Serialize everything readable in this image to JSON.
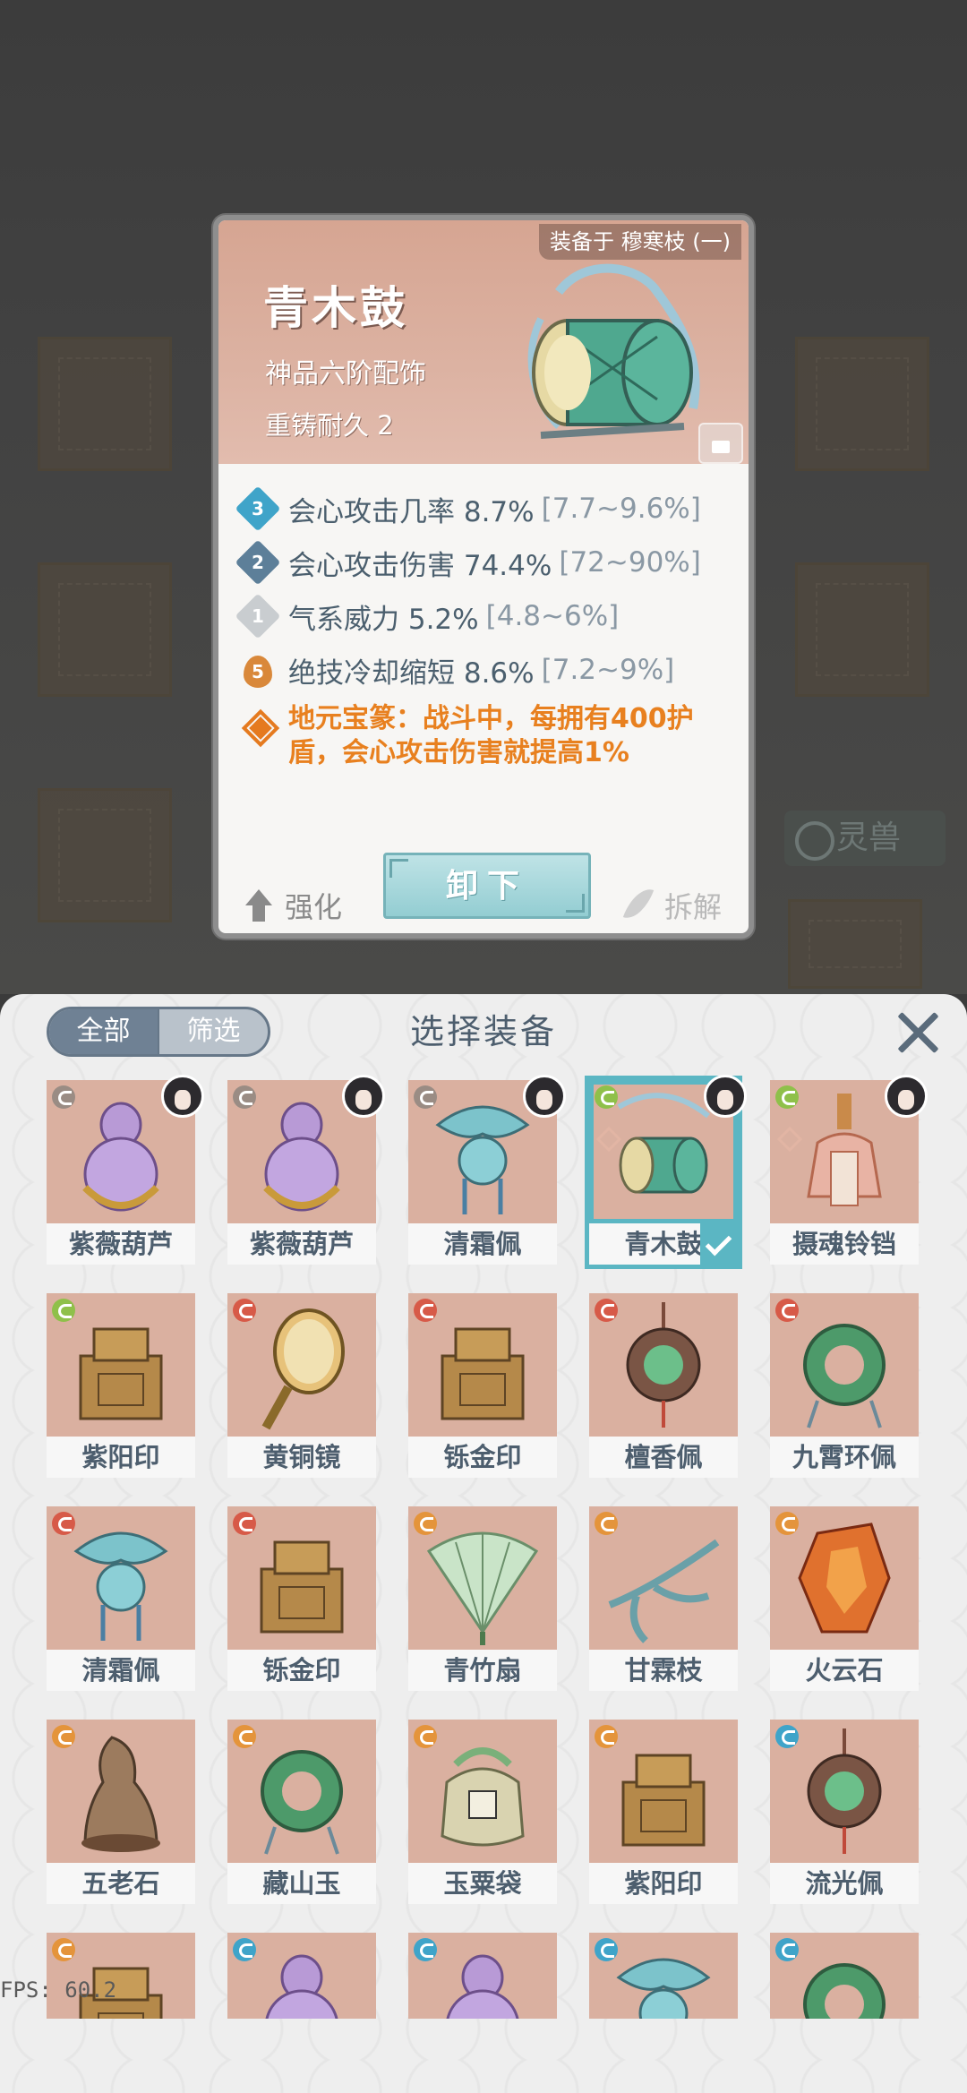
{
  "detail": {
    "equipped_by": "装备于 穆寒枝 (一)",
    "name": "青木鼓",
    "grade": "神品六阶配饰",
    "durability": "重铸耐久 2",
    "stats": [
      {
        "level": "3",
        "text": "会心攻击几率 8.7%",
        "range": "[7.7~9.6%]",
        "color": "#3fa4c9"
      },
      {
        "level": "2",
        "text": "会心攻击伤害 74.4%",
        "range": "[72~90%]",
        "color": "#5d7f99"
      },
      {
        "level": "1",
        "text": "气系威力 5.2%",
        "range": "[4.8~6%]",
        "color": "#c9cdd0"
      },
      {
        "level": "5",
        "text": "绝技冷却缩短 8.6%",
        "range": "[7.2~9%]",
        "color": "#d9883a"
      }
    ],
    "skill_text": "地元宝篆：战斗中，每拥有400护盾，会心攻击伤害就提高1%",
    "strengthen": "强化",
    "unequip": "卸下",
    "dismantle": "拆解"
  },
  "background": {
    "lingshou_label": "灵兽"
  },
  "panel": {
    "tab_all": "全部",
    "tab_filter": "筛选",
    "title": "选择装备"
  },
  "items": [
    {
      "name": "紫薇葫芦",
      "element": "#9a8c84",
      "art": "gourd",
      "avatar": true
    },
    {
      "name": "紫薇葫芦",
      "element": "#9a8c84",
      "art": "gourd",
      "avatar": true
    },
    {
      "name": "清霜佩",
      "element": "#9a8c84",
      "art": "pendant",
      "avatar": true
    },
    {
      "name": "青木鼓",
      "element": "#8fc04a",
      "art": "drum",
      "avatar": true,
      "selected": true
    },
    {
      "name": "摄魂铃铛",
      "element": "#8fc04a",
      "art": "bell",
      "avatar": true
    },
    {
      "name": "紫阳印",
      "element": "#8fc04a",
      "art": "seal",
      "avatar": false
    },
    {
      "name": "黄铜镜",
      "element": "#d75a48",
      "art": "mirror",
      "avatar": false
    },
    {
      "name": "铄金印",
      "element": "#d75a48",
      "art": "seal",
      "avatar": false
    },
    {
      "name": "檀香佩",
      "element": "#d75a48",
      "art": "jade",
      "avatar": false
    },
    {
      "name": "九霄环佩",
      "element": "#d75a48",
      "art": "ring",
      "avatar": false
    },
    {
      "name": "清霜佩",
      "element": "#d75a48",
      "art": "pendant",
      "avatar": false
    },
    {
      "name": "铄金印",
      "element": "#d75a48",
      "art": "seal",
      "avatar": false
    },
    {
      "name": "青竹扇",
      "element": "#e4943b",
      "art": "fan",
      "avatar": false
    },
    {
      "name": "甘霖枝",
      "element": "#e4943b",
      "art": "branch",
      "avatar": false
    },
    {
      "name": "火云石",
      "element": "#e4943b",
      "art": "stone",
      "avatar": false
    },
    {
      "name": "五老石",
      "element": "#e4943b",
      "art": "rock",
      "avatar": false
    },
    {
      "name": "藏山玉",
      "element": "#e4943b",
      "art": "ring",
      "avatar": false
    },
    {
      "name": "玉粟袋",
      "element": "#e4943b",
      "art": "bag",
      "avatar": false
    },
    {
      "name": "紫阳印",
      "element": "#e4943b",
      "art": "seal",
      "avatar": false
    },
    {
      "name": "流光佩",
      "element": "#3fa4c9",
      "art": "jade",
      "avatar": false
    },
    {
      "name": "",
      "element": "#e4943b",
      "art": "seal",
      "avatar": false
    },
    {
      "name": "",
      "element": "#3fa4c9",
      "art": "gourd",
      "avatar": false
    },
    {
      "name": "",
      "element": "#3fa4c9",
      "art": "gourd",
      "avatar": false
    },
    {
      "name": "",
      "element": "#3fa4c9",
      "art": "pendant",
      "avatar": false
    },
    {
      "name": "",
      "element": "#3fa4c9",
      "art": "ring",
      "avatar": false
    }
  ],
  "fps": "FPS: 60.2"
}
